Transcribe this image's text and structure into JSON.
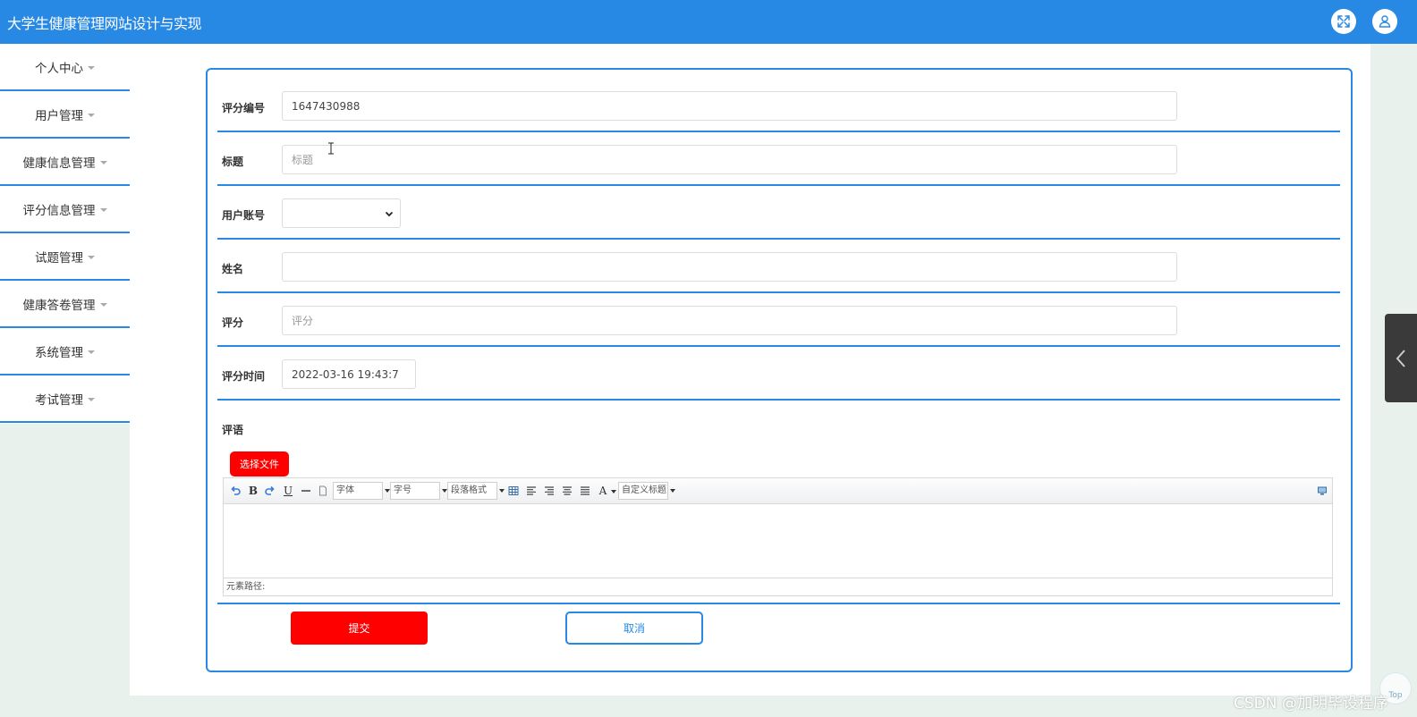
{
  "header": {
    "title": "大学生健康管理网站设计与实现",
    "fullscreen_icon": "fullscreen-icon",
    "user_icon": "user-icon"
  },
  "sidebar": {
    "items": [
      {
        "label": "个人中心"
      },
      {
        "label": "用户管理"
      },
      {
        "label": "健康信息管理"
      },
      {
        "label": "评分信息管理"
      },
      {
        "label": "试题管理"
      },
      {
        "label": "健康答卷管理"
      },
      {
        "label": "系统管理"
      },
      {
        "label": "考试管理"
      }
    ]
  },
  "form": {
    "score_no": {
      "label": "评分编号",
      "value": "1647430988"
    },
    "title": {
      "label": "标题",
      "value": "",
      "placeholder": "标题"
    },
    "user_account": {
      "label": "用户账号",
      "value": ""
    },
    "name": {
      "label": "姓名",
      "value": "",
      "placeholder": ""
    },
    "score": {
      "label": "评分",
      "value": "",
      "placeholder": "评分"
    },
    "score_time": {
      "label": "评分时间",
      "value": "2022-03-16 19:43:7"
    },
    "comment": {
      "label": "评语"
    }
  },
  "editor": {
    "choose_file": "选择文件",
    "font_family": "字体",
    "font_size": "字号",
    "paragraph": "段落格式",
    "custom_style": "自定义标题",
    "status_path": "元素路径:",
    "buttons": {
      "bold": "B",
      "underline": "U",
      "font_color": "A"
    }
  },
  "actions": {
    "submit": "提交",
    "cancel": "取消"
  },
  "widgets": {
    "top_label": "Top"
  },
  "watermark": "CSDN @加明毕设程序",
  "colors": {
    "primary": "#2889e5",
    "danger": "#ff0000",
    "page_bg": "#e8f1ec"
  }
}
